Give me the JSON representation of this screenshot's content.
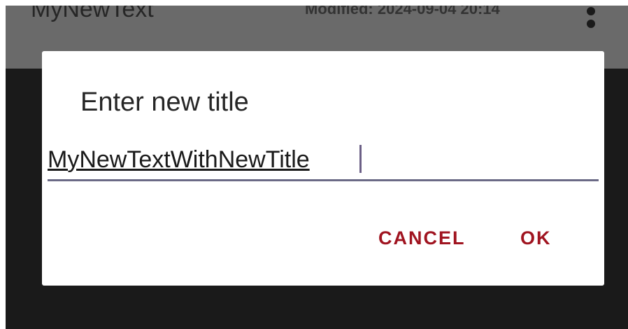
{
  "app_bar": {
    "title": "MyNewText",
    "modified": "Modified: 2024-09-04 20:14",
    "more_icon": "more-vert-icon"
  },
  "dialog": {
    "title": "Enter new title",
    "input_value": "MyNewTextWithNewTitle",
    "cancel_label": "CANCEL",
    "ok_label": "OK"
  },
  "colors": {
    "app_bar": "#6a6a6a",
    "scrim": "#1a1a1a",
    "dialog_background": "#ffffff",
    "button_text": "#a01420",
    "input_underline": "#6b6a86"
  }
}
